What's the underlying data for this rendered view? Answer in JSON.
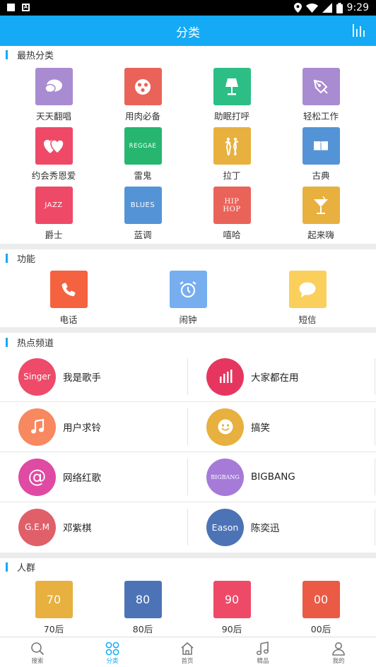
{
  "status_bar": {
    "time": "9:29",
    "a_icon_label": "A"
  },
  "header": {
    "title": "分类"
  },
  "sections": {
    "hot": {
      "title": "最热分类",
      "items": [
        {
          "label": "天天翻唱",
          "color": "#a98bd2"
        },
        {
          "label": "用肉必备",
          "color": "#ea6359"
        },
        {
          "label": "助眠打呼",
          "color": "#2cbe85"
        },
        {
          "label": "轻松工作",
          "color": "#a98bd2"
        },
        {
          "label": "约会秀恩爱",
          "color": "#ee4a68"
        },
        {
          "label": "雷鬼",
          "color": "#26b66f",
          "text": "REGGAE"
        },
        {
          "label": "拉丁",
          "color": "#e7b03f"
        },
        {
          "label": "古典",
          "color": "#5494d6"
        },
        {
          "label": "爵士",
          "color": "#ee4a68",
          "text": "JAZZ"
        },
        {
          "label": "蓝调",
          "color": "#5494d6",
          "text": "BLUES"
        },
        {
          "label": "嘻哈",
          "color": "#ea6359",
          "text": "HIP HOP"
        },
        {
          "label": "起来嗨",
          "color": "#e7b03f"
        }
      ]
    },
    "function": {
      "title": "功能",
      "items": [
        {
          "label": "电话",
          "color": "#f4623f"
        },
        {
          "label": "闹钟",
          "color": "#76aef0"
        },
        {
          "label": "短信",
          "color": "#fbcf5b"
        }
      ]
    },
    "channels": {
      "title": "热点频道",
      "items": [
        {
          "name": "我是歌手",
          "color": "#ee4a6a",
          "text": "Singer"
        },
        {
          "name": "大家都在用",
          "color": "#e63660"
        },
        {
          "name": "用户求铃",
          "color": "#f78860"
        },
        {
          "name": "搞笑",
          "color": "#e7b03f"
        },
        {
          "name": "网络红歌",
          "color": "#df4aa3",
          "text": "@"
        },
        {
          "name": "BIGBANG",
          "color": "#a57bd7",
          "text": "BIGBANG"
        },
        {
          "name": "邓紫棋",
          "color": "#e0606a",
          "text": "G.E.M"
        },
        {
          "name": "陈奕迅",
          "color": "#4d73b7",
          "text": "Eason"
        }
      ]
    },
    "crowd": {
      "title": "人群",
      "items": [
        {
          "label": "70后",
          "color": "#e7b03f",
          "text": "70"
        },
        {
          "label": "80后",
          "color": "#4d73b7",
          "text": "80"
        },
        {
          "label": "90后",
          "color": "#ee4a68",
          "text": "90"
        },
        {
          "label": "00后",
          "color": "#ea5a45",
          "text": "00"
        }
      ]
    }
  },
  "bottom_nav": [
    {
      "label": "搜索"
    },
    {
      "label": "分类",
      "active": true
    },
    {
      "label": "首页"
    },
    {
      "label": "精品"
    },
    {
      "label": "我的"
    }
  ],
  "colors": {
    "accent": "#14aaf5",
    "background": "#ececec"
  }
}
